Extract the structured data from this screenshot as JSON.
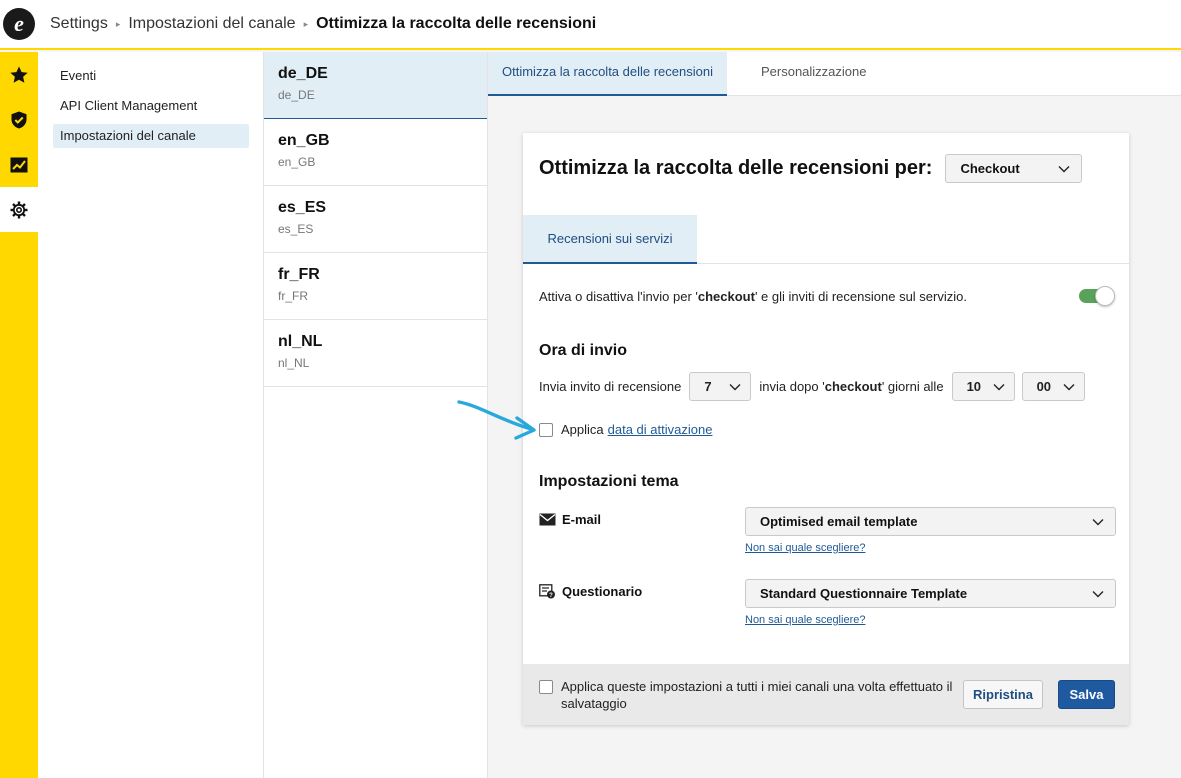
{
  "breadcrumb": {
    "items": [
      "Settings",
      "Impostazioni del canale"
    ],
    "current": "Ottimizza la raccolta delle recensioni",
    "separator": "▸"
  },
  "rail": {
    "items": [
      {
        "icon": "star-icon"
      },
      {
        "icon": "shield-icon"
      },
      {
        "icon": "chart-icon"
      },
      {
        "icon": "gear-icon",
        "active": true
      }
    ],
    "color": "#ffd800"
  },
  "nav": {
    "items": [
      {
        "label": "Eventi"
      },
      {
        "label": "API Client Management"
      },
      {
        "label": "Impostazioni del canale",
        "active": true
      }
    ]
  },
  "locales": [
    {
      "code": "de_DE",
      "sub": "de_DE",
      "active": true
    },
    {
      "code": "en_GB",
      "sub": "en_GB"
    },
    {
      "code": "es_ES",
      "sub": "es_ES"
    },
    {
      "code": "fr_FR",
      "sub": "fr_FR"
    },
    {
      "code": "nl_NL",
      "sub": "nl_NL"
    }
  ],
  "main_tabs": [
    {
      "label": "Ottimizza la raccolta delle recensioni",
      "active": true
    },
    {
      "label": "Personalizzazione"
    }
  ],
  "card": {
    "title": "Ottimizza la raccolta delle recensioni per:",
    "trigger_select": "Checkout",
    "inner_tab": "Recensioni sui servizi",
    "toggle": {
      "text_before": "Attiva o disattiva l'invio per '",
      "text_bold": "checkout",
      "text_after": "' e gli inviti di recensione sul servizio.",
      "on": true
    },
    "send_time": {
      "title": "Ora di invio",
      "label1": "Invia invito di recensione",
      "days": "7",
      "label2_before": "invia dopo '",
      "label2_bold": "checkout",
      "label2_after": "' giorni alle",
      "hour": "10",
      "minute": "00"
    },
    "activation": {
      "label": "Applica",
      "link": "data di attivazione"
    },
    "theme": {
      "title": "Impostazioni tema",
      "email_label": "E-mail",
      "email_value": "Optimised email template",
      "email_help": "Non sai quale scegliere?",
      "quest_label": "Questionario",
      "quest_value": "Standard Questionnaire Template",
      "quest_help": "Non sai quale scegliere?"
    },
    "footer": {
      "apply_all": "Applica queste impostazioni a tutti i miei canali una volta effettuato il salvataggio",
      "reset": "Ripristina",
      "save": "Salva"
    }
  },
  "annotation": {
    "arrow_color": "#29a8dc"
  }
}
